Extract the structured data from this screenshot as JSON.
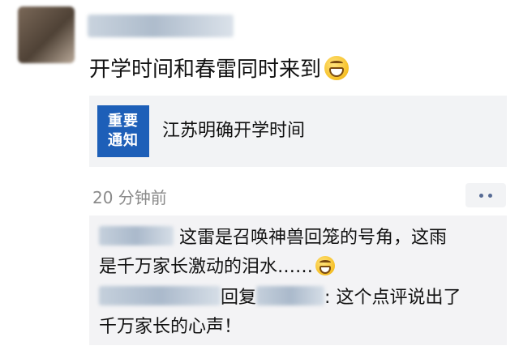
{
  "post": {
    "text": "开学时间和春雷同时来到",
    "emoji_icon": "grinning-face-emoji"
  },
  "link_card": {
    "thumb_line1": "重要",
    "thumb_line2": "通知",
    "title": "江苏明确开学时间",
    "thumb_color": "#1d5fb8"
  },
  "meta": {
    "timestamp": "20 分钟前",
    "more_icon": "more-dots-icon"
  },
  "comments": [
    {
      "text_line1": "这雷是召唤神兽回笼的号角，这雨",
      "text_line2": "是千万家长激动的泪水……"
    },
    {
      "reply_label": "回复",
      "colon": ":",
      "text_line1": "这个点评说出了",
      "text_line2": "千万家长的心声！"
    }
  ],
  "colors": {
    "link_blue": "#576b95",
    "background": "#ffffff",
    "panel_grey": "#f2f3f5"
  }
}
